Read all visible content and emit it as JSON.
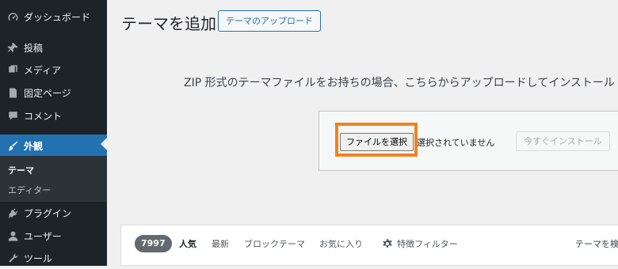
{
  "sidebar": {
    "items": [
      {
        "label": "ダッシュボード",
        "icon": "dashboard-icon"
      },
      {
        "label": "投稿",
        "icon": "pin-icon"
      },
      {
        "label": "メディア",
        "icon": "media-icon"
      },
      {
        "label": "固定ページ",
        "icon": "page-icon"
      },
      {
        "label": "コメント",
        "icon": "comment-icon"
      },
      {
        "label": "外観",
        "icon": "brush-icon"
      },
      {
        "label": "プラグイン",
        "icon": "plugin-icon"
      },
      {
        "label": "ユーザー",
        "icon": "user-icon"
      },
      {
        "label": "ツール",
        "icon": "wrench-icon"
      }
    ],
    "submenu": [
      {
        "label": "テーマ"
      },
      {
        "label": "エディター"
      }
    ],
    "accent_color": "#2271b1"
  },
  "header": {
    "title": "テーマを追加",
    "upload_button": "テーマのアップロード"
  },
  "upload": {
    "description": "ZIP 形式のテーマファイルをお持ちの場合、こちらからアップロードしてインストール",
    "choose_file": "ファイルを選択",
    "no_file": "選択されていません",
    "install_button": "今すぐインストール",
    "highlight_color": "#f08321"
  },
  "filter": {
    "count": "7997",
    "tabs": [
      "人気",
      "最新",
      "ブロックテーマ",
      "お気に入り",
      "特徴フィルター"
    ],
    "search_label": "テーマを検"
  }
}
